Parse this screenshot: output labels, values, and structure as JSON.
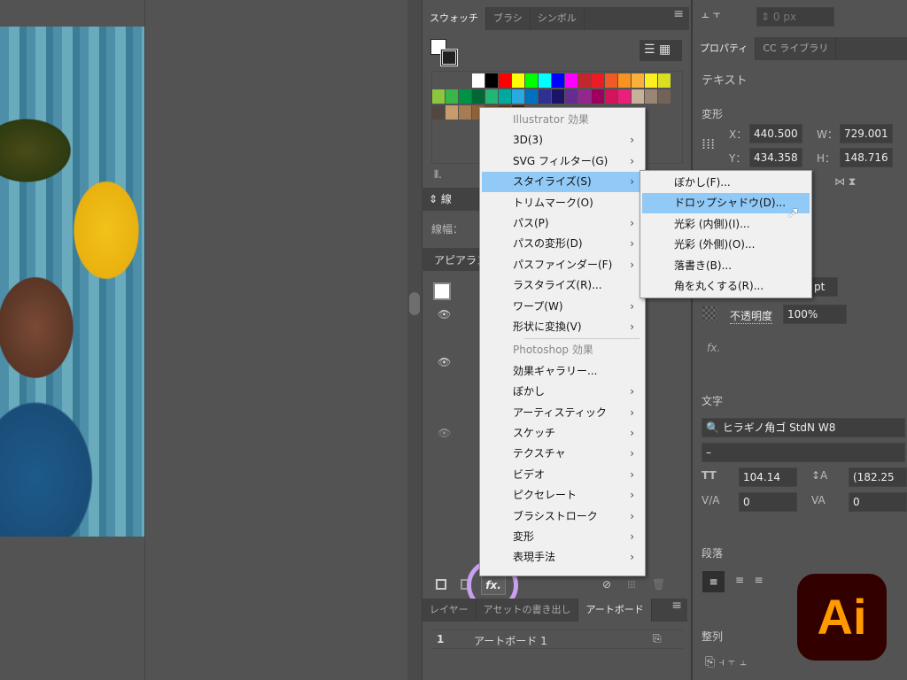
{
  "swatches_panel": {
    "tabs": [
      "スウォッチ",
      "ブラシ",
      "シンボル"
    ],
    "active": 0,
    "colors": [
      "#ffffff",
      "#000000",
      "#ff0000",
      "#ffff00",
      "#00ff00",
      "#00ffff",
      "#0000ff",
      "#ff00ff",
      "#c1272d",
      "#ed1c24",
      "#f15a24",
      "#f7931e",
      "#fbb03b",
      "#fcee21",
      "#d9e021",
      "#8cc63f",
      "#39b54a",
      "#009245",
      "#006837",
      "#22b573",
      "#00a99d",
      "#29abe2",
      "#0071bc",
      "#2e3192",
      "#1b1464",
      "#662d91",
      "#93278f",
      "#9e005d",
      "#d4145a",
      "#ed1e79",
      "#c7b299",
      "#998675",
      "#736357",
      "#534741",
      "#c69c6d",
      "#a67c52",
      "#8c6239",
      "#754c24",
      "#603813",
      "#42210b"
    ]
  },
  "stroke_panel": {
    "title": "線",
    "width_label": "線幅："
  },
  "appearance_panel": {
    "title": "アピアランス"
  },
  "bottom_panel": {
    "tabs": [
      "レイヤー",
      "アセットの書き出し",
      "アートボード"
    ],
    "active": 2,
    "row_number": "1",
    "row_name": "アートボード 1"
  },
  "effect_menu": {
    "items": [
      {
        "label": "Illustrator 効果",
        "header": true
      },
      {
        "label": "3D(3)",
        "arrow": true
      },
      {
        "label": "SVG フィルター(G)",
        "arrow": true
      },
      {
        "label": "スタイライズ(S)",
        "arrow": true,
        "selected": true
      },
      {
        "label": "トリムマーク(O)"
      },
      {
        "label": "パス(P)",
        "arrow": true
      },
      {
        "label": "パスの変形(D)",
        "arrow": true
      },
      {
        "label": "パスファインダー(F)",
        "arrow": true
      },
      {
        "label": "ラスタライズ(R)..."
      },
      {
        "label": "ワープ(W)",
        "arrow": true
      },
      {
        "label": "形状に変換(V)",
        "arrow": true
      },
      {
        "label": "Photoshop 効果",
        "header": true
      },
      {
        "label": "効果ギャラリー..."
      },
      {
        "label": "ぼかし",
        "arrow": true
      },
      {
        "label": "アーティスティック",
        "arrow": true
      },
      {
        "label": "スケッチ",
        "arrow": true
      },
      {
        "label": "テクスチャ",
        "arrow": true
      },
      {
        "label": "ビデオ",
        "arrow": true
      },
      {
        "label": "ピクセレート",
        "arrow": true
      },
      {
        "label": "ブラシストローク",
        "arrow": true
      },
      {
        "label": "変形",
        "arrow": true
      },
      {
        "label": "表現手法",
        "arrow": true
      }
    ]
  },
  "stylize_submenu": {
    "items": [
      {
        "label": "ぼかし(F)..."
      },
      {
        "label": "ドロップシャドウ(D)...",
        "selected": true
      },
      {
        "label": "光彩 (内側)(I)..."
      },
      {
        "label": "光彩 (外側)(O)..."
      },
      {
        "label": "落書き(B)..."
      },
      {
        "label": "角を丸くする(R)..."
      }
    ]
  },
  "fx_button": "fx.",
  "properties": {
    "top_value": "0 px",
    "tabs": [
      "プロパティ",
      "CC ライブラリ"
    ],
    "section": "テキスト",
    "transform": {
      "title": "変形",
      "x_label": "X：",
      "x": "440.500",
      "y_label": "Y：",
      "y": "434.358",
      "w_label": "W：",
      "w": "729.001",
      "h_label": "H：",
      "h": "148.716"
    },
    "stroke_unit": "pt",
    "opacity_label": "不透明度",
    "opacity": "100%",
    "fx": "fx.",
    "character": {
      "title": "文字",
      "font": "ヒラギノ角ゴ StdN W8",
      "style": "–",
      "size": "104.14",
      "leading": "(182.25",
      "kerning": "0",
      "tracking": "0"
    },
    "paragraph": {
      "title": "段落"
    },
    "align": {
      "title": "整列"
    }
  },
  "app_logo": "Ai"
}
